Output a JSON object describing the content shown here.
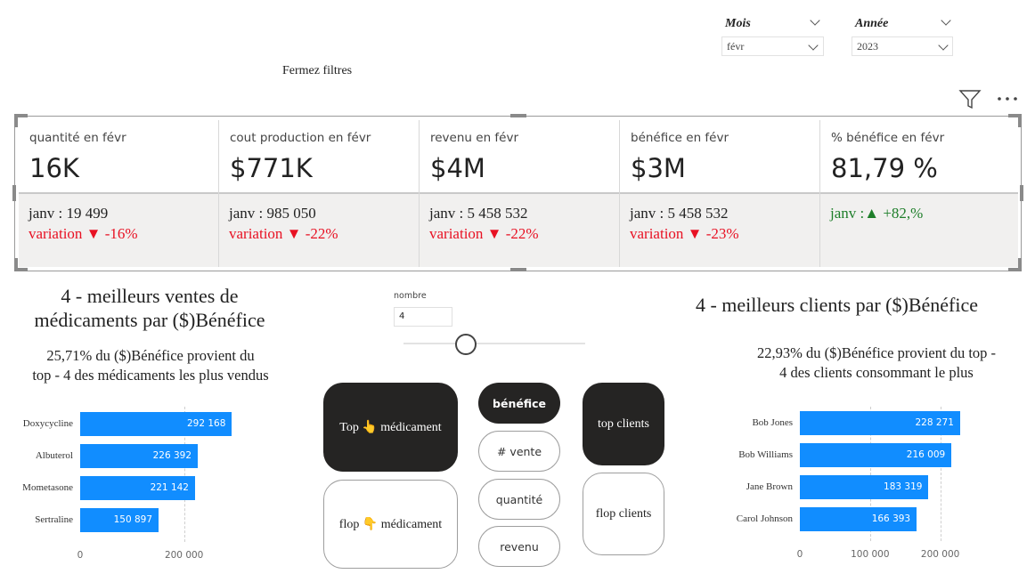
{
  "filters": {
    "month": {
      "title": "Mois",
      "value": "févr"
    },
    "year": {
      "title": "Année",
      "value": "2023"
    },
    "close_label": "Fermez filtres"
  },
  "toolbar": {
    "filter_icon": "filter-icon",
    "more_icon": "more-options-icon"
  },
  "kpis": [
    {
      "label": "quantité en févr",
      "value": "16K",
      "prev": "janv : 19 499",
      "variation": "variation ▼ -16%",
      "trend": "down"
    },
    {
      "label": "cout production en févr",
      "value": "$771K",
      "prev": "janv : 985 050",
      "variation": "variation ▼ -22%",
      "trend": "down"
    },
    {
      "label": "revenu en févr",
      "value": "$4M",
      "prev": "janv : 5 458 532",
      "variation": "variation ▼ -22%",
      "trend": "down"
    },
    {
      "label": "bénéfice en févr",
      "value": "$3M",
      "prev": "janv : 5 458 532",
      "variation": "variation ▼ -23%",
      "trend": "down"
    },
    {
      "label": "% bénéfice en févr",
      "value": "81,79 %",
      "prev": "janv :▲ +82,%",
      "variation": "",
      "trend": "up"
    }
  ],
  "left": {
    "heading_line1": "4 - meilleurs ventes de",
    "heading_line2": "médicaments par ($)Bénéfice",
    "sub_line1": "25,71% du ($)Bénéfice provient du",
    "sub_line2": "top - 4 des médicaments les plus vendus"
  },
  "right": {
    "heading": "4 - meilleurs clients par ($)Bénéfice",
    "sub_line1": "22,93% du ($)Bénéfice provient du top -",
    "sub_line2": "4 des clients consommant le plus"
  },
  "nombre": {
    "label": "nombre",
    "value": "4"
  },
  "buttons": {
    "top_med": "Top 👆 médicament",
    "flop_med": "flop 👇 médicament",
    "top_clients": "top clients",
    "flop_clients": "flop clients",
    "metrics": [
      "bénéfice",
      "# vente",
      "quantité",
      "revenu"
    ]
  },
  "colors": {
    "bar": "#118dff",
    "negative": "#e81123",
    "positive": "#1e7e2a",
    "dark_button": "#252423"
  },
  "chart_data": [
    {
      "type": "bar",
      "orientation": "horizontal",
      "categories": [
        "Doxycycline",
        "Albuterol",
        "Mometasone",
        "Sertraline"
      ],
      "values": [
        292168,
        226392,
        221142,
        150897
      ],
      "value_labels": [
        "292 168",
        "226 392",
        "221 142",
        "150 897"
      ],
      "xlim": [
        0,
        300000
      ],
      "ticks": [
        0,
        200000
      ],
      "tick_labels": [
        "0",
        "200 000"
      ]
    },
    {
      "type": "bar",
      "orientation": "horizontal",
      "categories": [
        "Bob Jones",
        "Bob Williams",
        "Jane Brown",
        "Carol Johnson"
      ],
      "values": [
        228271,
        216009,
        183319,
        166393
      ],
      "value_labels": [
        "228 271",
        "216 009",
        "183 319",
        "166 393"
      ],
      "xlim": [
        0,
        250000
      ],
      "ticks": [
        0,
        100000,
        200000
      ],
      "tick_labels": [
        "0",
        "100 000",
        "200 000"
      ]
    }
  ]
}
